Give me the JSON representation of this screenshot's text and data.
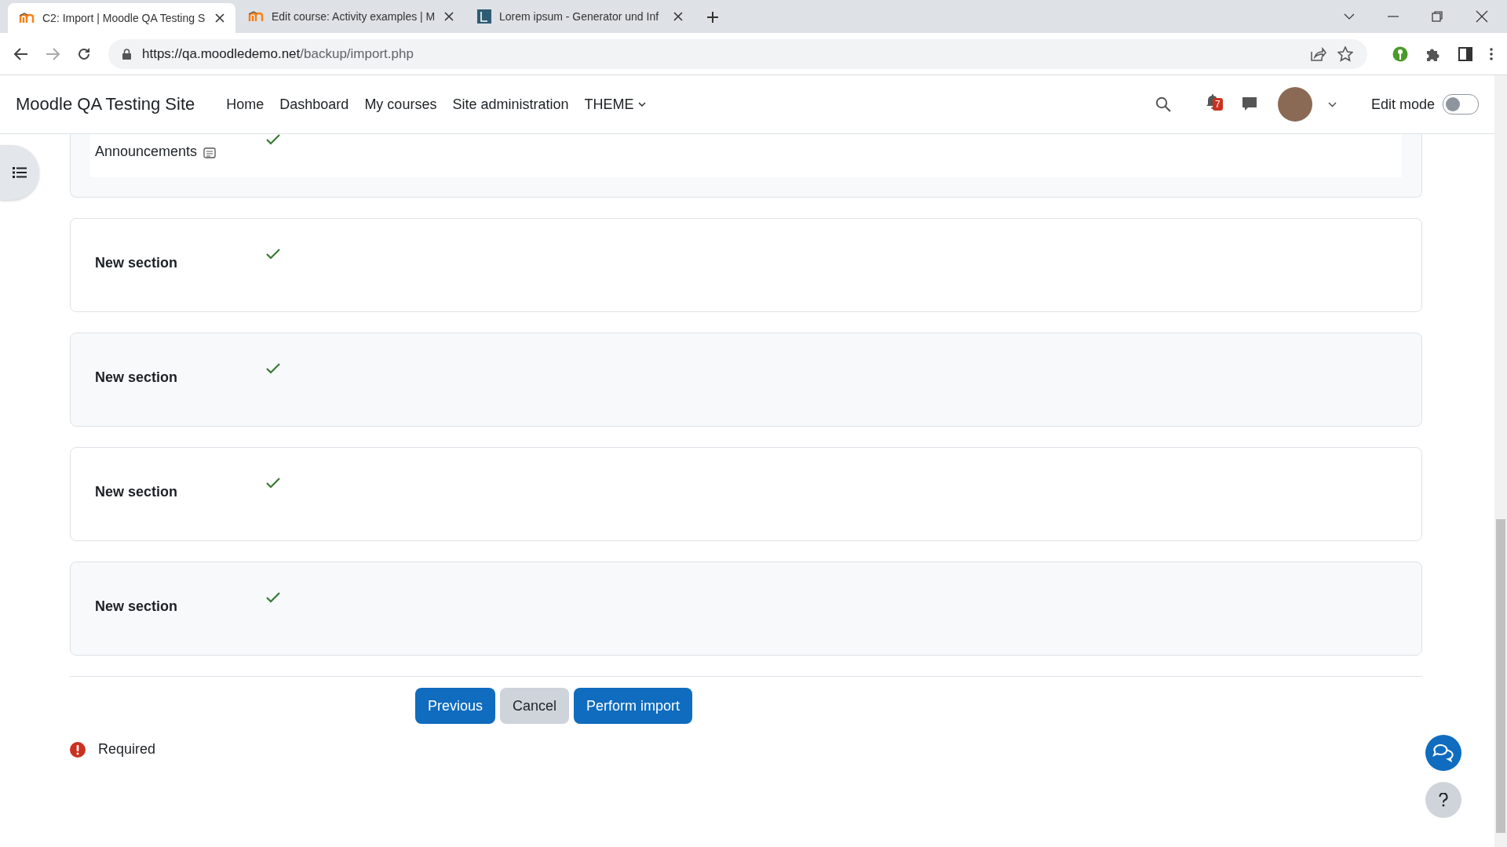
{
  "browser": {
    "tabs": [
      {
        "title": "C2: Import | Moodle QA Testing S",
        "selected": true,
        "kind": "moodle"
      },
      {
        "title": "Edit course: Activity examples | M",
        "selected": false,
        "kind": "moodle"
      },
      {
        "title": "Lorem ipsum - Generator und Inf",
        "selected": false,
        "kind": "letter"
      }
    ],
    "url_host": "https://qa.moodledemo.net",
    "url_path": "/backup/import.php"
  },
  "navbar": {
    "site_name": "Moodle QA Testing Site",
    "links": [
      "Home",
      "Dashboard",
      "My courses",
      "Site administration"
    ],
    "menu": "THEME",
    "notification_count": "7",
    "edit_mode": {
      "label": "Edit mode",
      "on": false
    }
  },
  "top_item": {
    "label": "Announcements",
    "included": true
  },
  "sections": [
    {
      "label": "New section",
      "included": true
    },
    {
      "label": "New section",
      "included": true
    },
    {
      "label": "New section",
      "included": true
    },
    {
      "label": "New section",
      "included": true
    }
  ],
  "buttons": [
    {
      "label": "Previous",
      "kind": "primary"
    },
    {
      "label": "Cancel",
      "kind": "secondary"
    },
    {
      "label": "Perform import",
      "kind": "primary"
    }
  ],
  "required_note": "Required"
}
